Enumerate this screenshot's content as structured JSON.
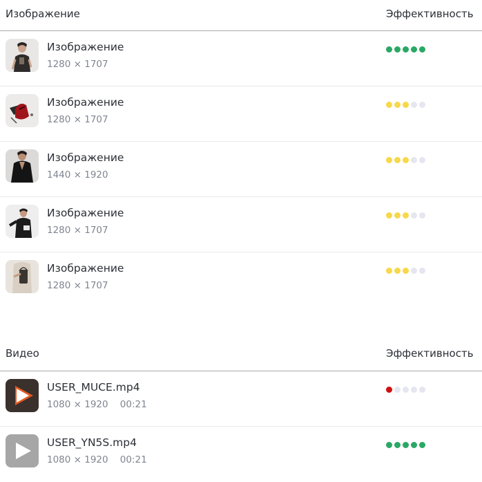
{
  "images_section": {
    "header_left": "Изображение",
    "header_right": "Эффективность",
    "rows": [
      {
        "title": "Изображение",
        "meta": "1280 × 1707",
        "rating": [
          "green",
          "green",
          "green",
          "green",
          "green"
        ],
        "thumb": "woman-dark-top-photo"
      },
      {
        "title": "Изображение",
        "meta": "1280 × 1707",
        "rating": [
          "yellow",
          "yellow",
          "yellow",
          "empty",
          "empty"
        ],
        "thumb": "red-bag-photo"
      },
      {
        "title": "Изображение",
        "meta": "1440 × 1920",
        "rating": [
          "yellow",
          "yellow",
          "yellow",
          "empty",
          "empty"
        ],
        "thumb": "woman-black-blouse-photo"
      },
      {
        "title": "Изображение",
        "meta": "1280 × 1707",
        "rating": [
          "yellow",
          "yellow",
          "yellow",
          "empty",
          "empty"
        ],
        "thumb": "woman-black-sweater-photo"
      },
      {
        "title": "Изображение",
        "meta": "1280 × 1707",
        "rating": [
          "yellow",
          "yellow",
          "yellow",
          "empty",
          "empty"
        ],
        "thumb": "beige-outfit-photo"
      }
    ]
  },
  "videos_section": {
    "header_left": "Видео",
    "header_right": "Эффективность",
    "rows": [
      {
        "title": "USER_MUCE.mp4",
        "meta": "1080 × 1920    00:21",
        "rating": [
          "red",
          "empty",
          "empty",
          "empty",
          "empty"
        ],
        "thumb": "video-play-dark"
      },
      {
        "title": "USER_YN5S.mp4",
        "meta": "1080 × 1920    00:21",
        "rating": [
          "green",
          "green",
          "green",
          "green",
          "green"
        ],
        "thumb": "video-play-grey"
      }
    ]
  },
  "colors": {
    "green": "#2aa865",
    "yellow": "#f8d84a",
    "red": "#d40f0f",
    "empty": "#e6e6f0"
  }
}
